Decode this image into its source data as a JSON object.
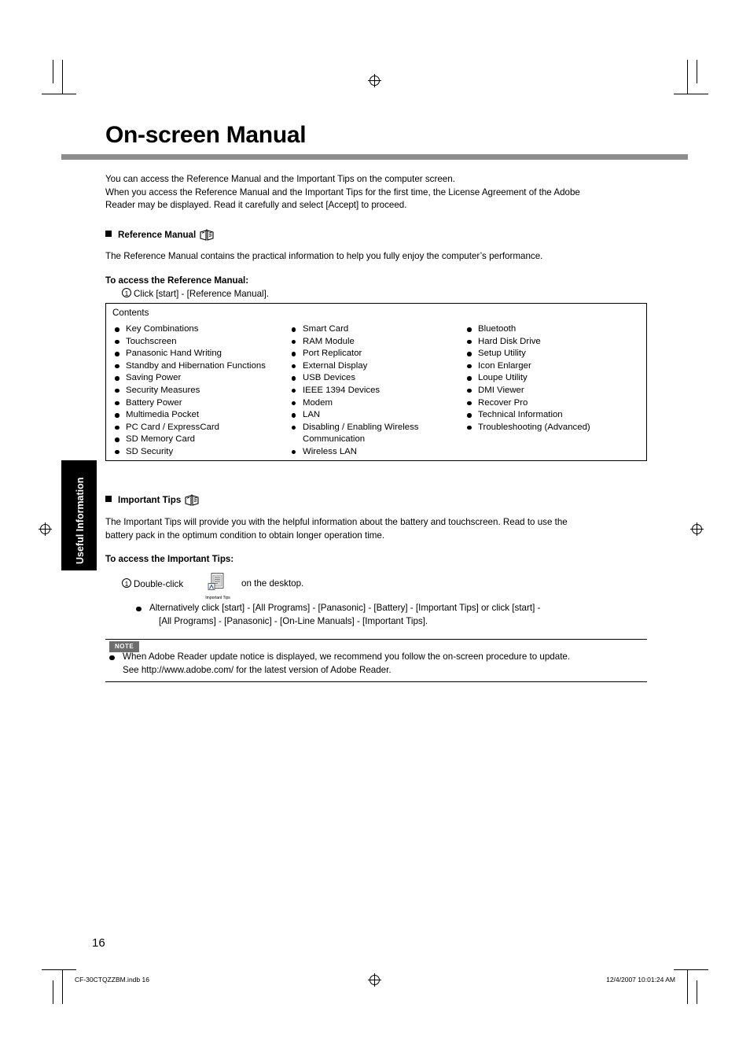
{
  "document": {
    "title": "On-screen Manual",
    "page_number": "16",
    "side_tab": "Useful Information",
    "footer_left": "CF-30CTQZZBM.indb   16",
    "footer_right": "12/4/2007   10:01:24 AM"
  },
  "intro": {
    "line1": "You can access the Reference Manual and the Important Tips on the computer screen.",
    "line2": "When you access the Reference Manual and the Important Tips for the first time, the License Agreement of the Adobe",
    "line3": "Reader may be displayed. Read it carefully and select [Accept] to proceed."
  },
  "reference_manual": {
    "heading": "Reference Manual",
    "description": "The Reference Manual contains the practical information to help you fully enjoy the computer’s performance.",
    "access_heading": "To access the Reference Manual:",
    "step1": "Click [start] - [Reference Manual].",
    "contents_label": "Contents",
    "columns": [
      [
        "Key Combinations",
        "Touchscreen",
        "Panasonic Hand Writing",
        "Standby and Hibernation Functions",
        "Saving Power",
        "Security Measures",
        "Battery Power",
        "Multimedia Pocket",
        "PC Card / ExpressCard",
        "SD Memory Card",
        "SD Security"
      ],
      [
        "Smart Card",
        "RAM Module",
        "Port Replicator",
        "External Display",
        "USB Devices",
        "IEEE 1394 Devices",
        "Modem",
        "LAN",
        "Disabling / Enabling Wireless",
        "Communication",
        "Wireless LAN"
      ],
      [
        "Bluetooth",
        "Hard Disk Drive",
        "Setup Utility",
        "Icon Enlarger",
        "Loupe Utility",
        "DMI Viewer",
        "Recover Pro",
        "Technical Information",
        "Troubleshooting (Advanced)"
      ]
    ]
  },
  "important_tips": {
    "heading": "Important Tips",
    "description_line1": "The Important Tips will provide you with the helpful information about the battery and touchscreen. Read to use the",
    "description_line2": "battery pack in the optimum condition to obtain longer operation time.",
    "access_heading": "To access the Important Tips:",
    "step1_prefix": "Double-click",
    "step1_suffix": "on the desktop.",
    "desktop_icon_caption": "Important Tips",
    "bullet_line1": "Alternatively click [start] - [All Programs] - [Panasonic] - [Battery] - [Important Tips] or click [start] -",
    "bullet_line2": "[All Programs] - [Panasonic] - [On-Line Manuals] - [Important Tips]."
  },
  "note": {
    "tag": "NOTE",
    "line1": "When Adobe Reader update notice is displayed, we recommend you follow the on-screen procedure to update.",
    "line2": "See http://www.adobe.com/ for the latest version of Adobe Reader."
  },
  "colors": {
    "rule": "#8d8d8d",
    "note_tag_bg": "#6d6d6d",
    "side_tab_bg": "#000000"
  }
}
